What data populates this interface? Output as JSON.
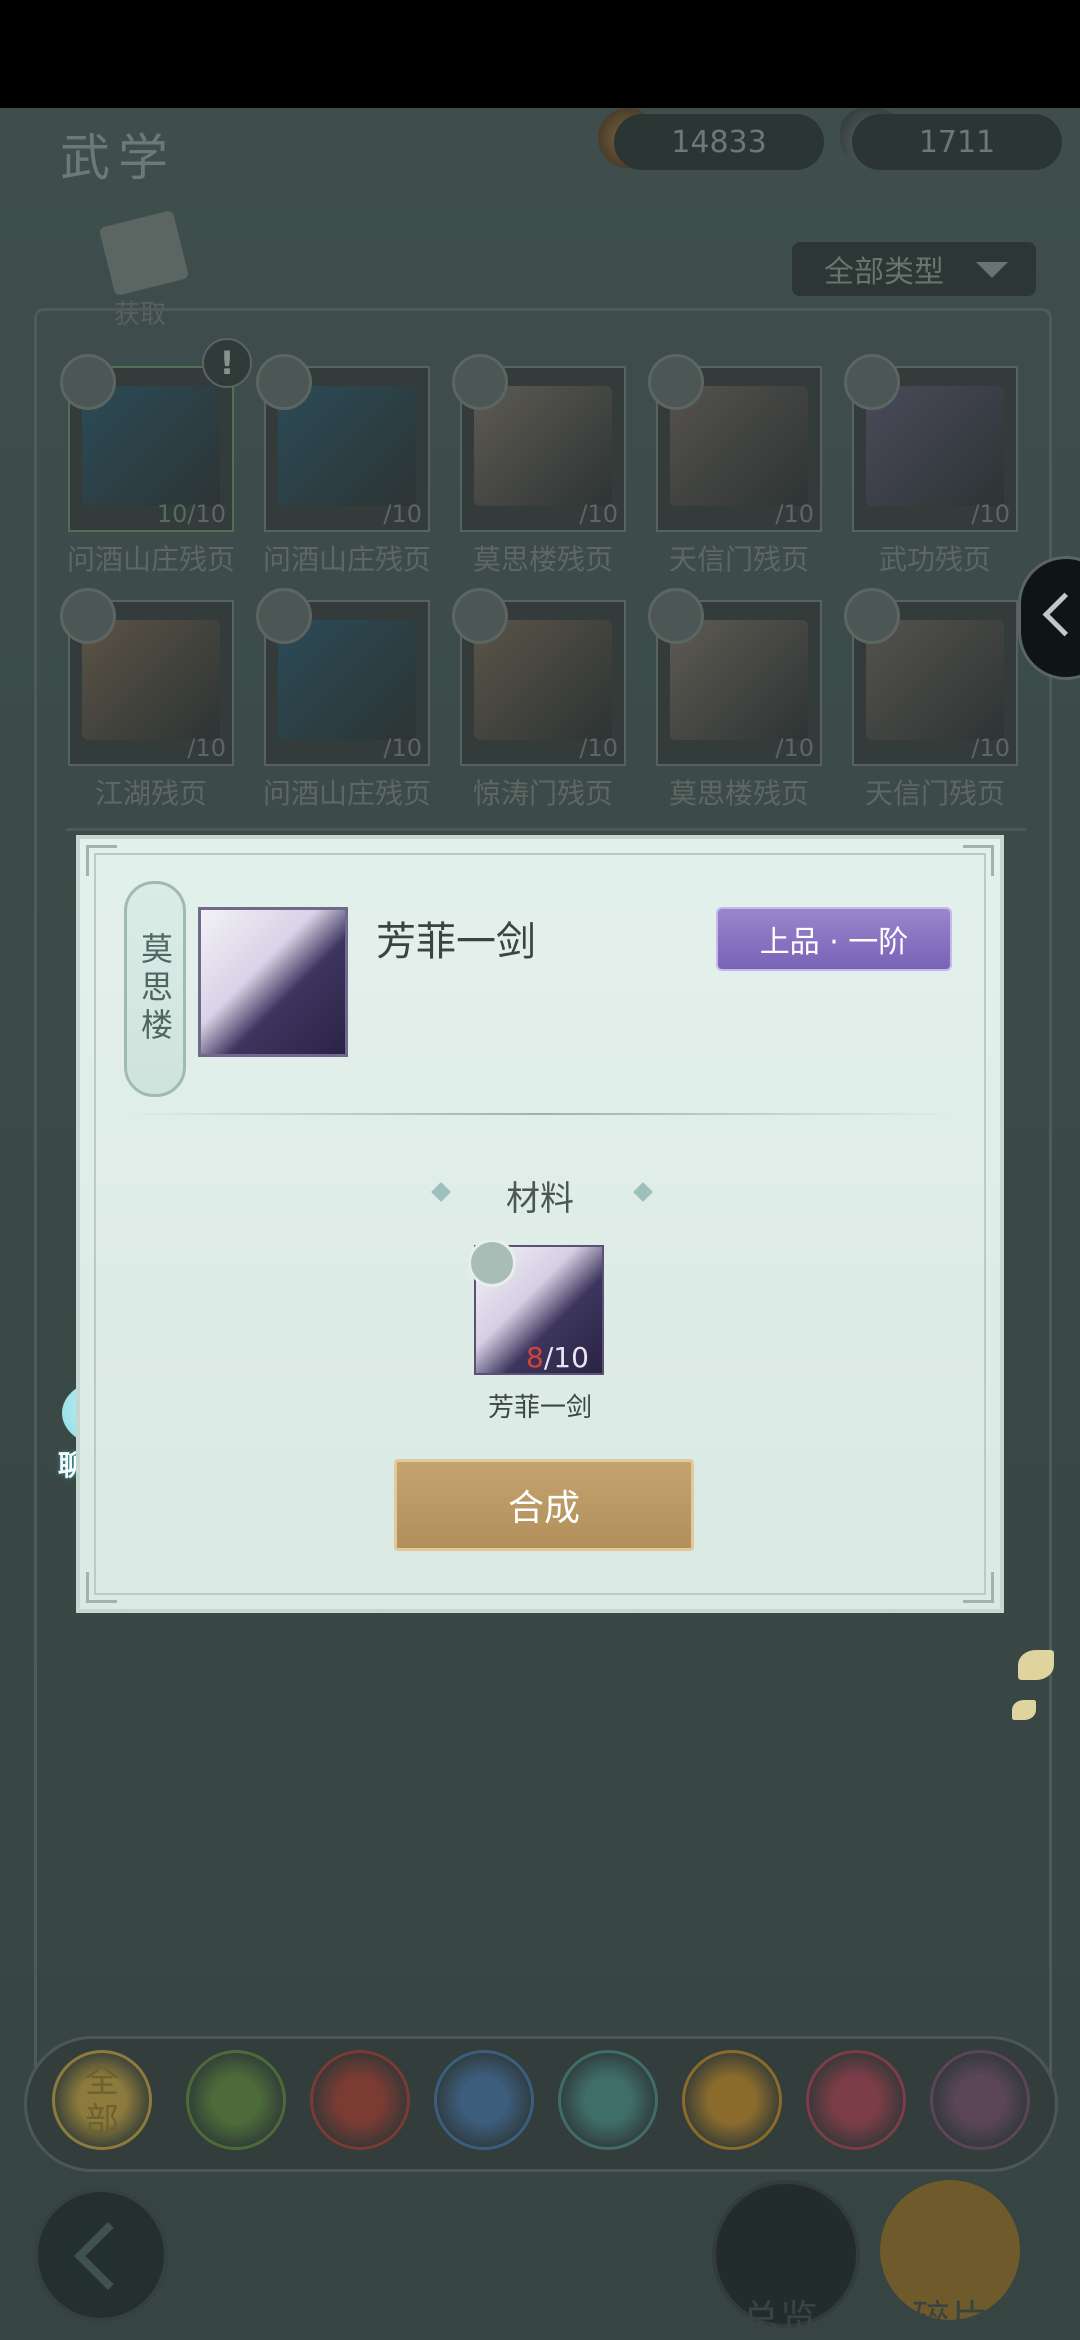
{
  "screen": {
    "title": "武学"
  },
  "currency": {
    "copper": "14833",
    "silver": "1711"
  },
  "get_button": {
    "label": "获取"
  },
  "filter": {
    "label": "全部类型"
  },
  "items": [
    {
      "name": "问酒山庄残页",
      "have": "10",
      "need": "/10",
      "color": "#2b4b57",
      "alert": "!"
    },
    {
      "name": "问酒山庄残页",
      "have": "",
      "need": "/10",
      "color": "#2b4b57"
    },
    {
      "name": "莫思楼残页",
      "have": "",
      "need": "/10",
      "color": "#5e5a53"
    },
    {
      "name": "天信门残页",
      "have": "",
      "need": "/10",
      "color": "#55524d"
    },
    {
      "name": "武功残页",
      "have": "",
      "need": "/10",
      "color": "#4a4a5a"
    },
    {
      "name": "江湖残页",
      "have": "",
      "need": "/10",
      "color": "#5b5346"
    },
    {
      "name": "问酒山庄残页",
      "have": "",
      "need": "/10",
      "color": "#2b4b57"
    },
    {
      "name": "惊涛门残页",
      "have": "",
      "need": "/10",
      "color": "#5a5448"
    },
    {
      "name": "莫思楼残页",
      "have": "",
      "need": "/10",
      "color": "#5e5a53"
    },
    {
      "name": "天信门残页",
      "have": "",
      "need": "/10",
      "color": "#55524d"
    }
  ],
  "modal": {
    "sect": "莫思楼",
    "skill_name": "芳菲一剑",
    "grade": "上品 · 一阶",
    "materials_title": "材料",
    "material": {
      "name": "芳菲一剑",
      "have": "8",
      "need": "/10"
    },
    "synthesize_label": "合成"
  },
  "chat": {
    "label": "聊天"
  },
  "categories": [
    {
      "label": "全\n部",
      "color": "#8c7b3c"
    },
    {
      "label": "",
      "color": "#4d6b3a"
    },
    {
      "label": "",
      "color": "#7a3b33"
    },
    {
      "label": "",
      "color": "#3c5d7c"
    },
    {
      "label": "",
      "color": "#3f6d68"
    },
    {
      "label": "",
      "color": "#8a6b2c"
    },
    {
      "label": "",
      "color": "#7b3d47"
    },
    {
      "label": "",
      "color": "#5b4658"
    }
  ],
  "bottom_nav": {
    "overview": "总览",
    "fragments": "碎片"
  }
}
